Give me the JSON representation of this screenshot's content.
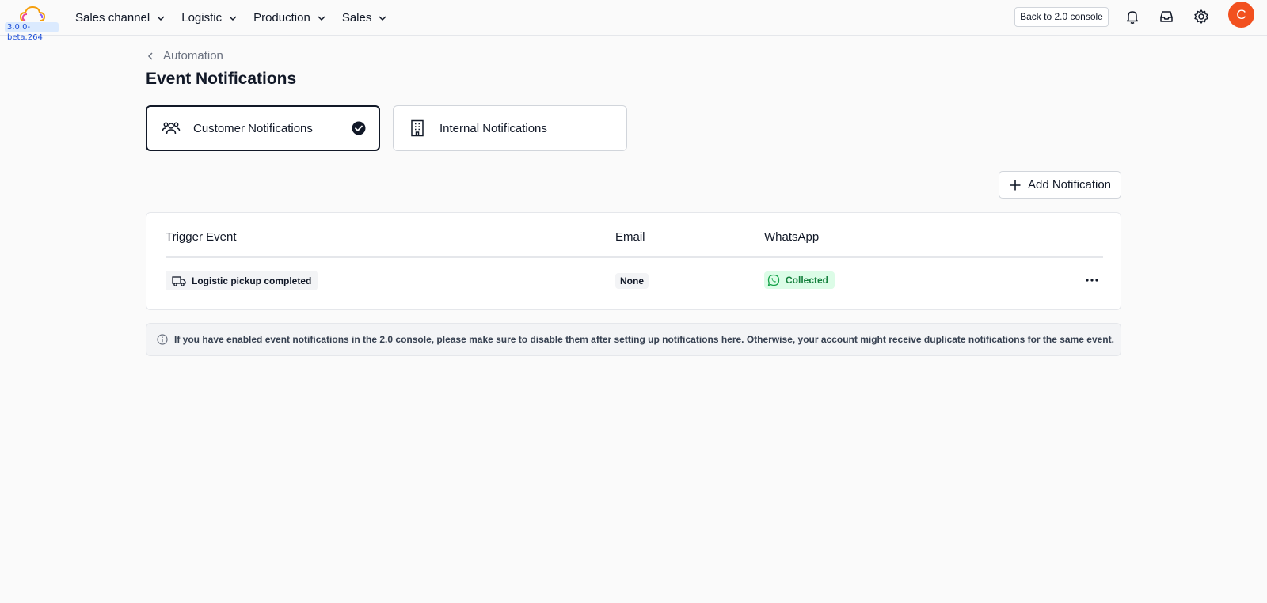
{
  "header": {
    "version": "3.0.0-beta.264",
    "nav": [
      {
        "label": "Sales channel"
      },
      {
        "label": "Logistic"
      },
      {
        "label": "Production"
      },
      {
        "label": "Sales"
      }
    ],
    "back_button": "Back to 2.0 console",
    "avatar_initial": "C",
    "avatar_color": "#f2501f"
  },
  "breadcrumb": {
    "label": "Automation"
  },
  "page": {
    "title": "Event Notifications"
  },
  "tabs": [
    {
      "label": "Customer Notifications",
      "icon": "people-icon",
      "active": true
    },
    {
      "label": "Internal Notifications",
      "icon": "building-icon",
      "active": false
    }
  ],
  "add_button": {
    "label": "Add Notification"
  },
  "table": {
    "columns": [
      "Trigger Event",
      "Email",
      "WhatsApp"
    ],
    "rows": [
      {
        "event": "Logistic pickup completed",
        "email": "None",
        "whatsapp": "Collected"
      }
    ]
  },
  "info_banner": {
    "text": "If you have enabled event notifications in the 2.0 console, please make sure to disable them after setting up notifications here. Otherwise, your account might receive duplicate notifications for the same event."
  }
}
